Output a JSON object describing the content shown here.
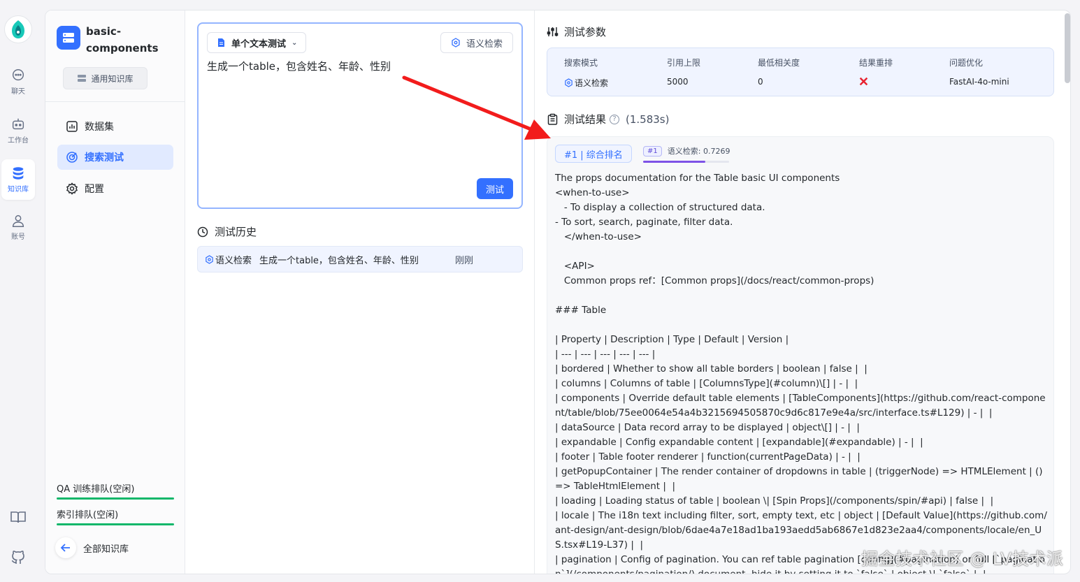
{
  "rail": {
    "items": [
      {
        "label": "聊天",
        "icon": "chat-icon"
      },
      {
        "label": "工作台",
        "icon": "robot-icon"
      },
      {
        "label": "知识库",
        "icon": "database-icon",
        "active": true
      },
      {
        "label": "账号",
        "icon": "user-icon"
      }
    ],
    "bottom_icons": [
      "book-icon",
      "github-icon"
    ]
  },
  "sidebar": {
    "kb_name": "basic-components",
    "kb_type": "通用知识库",
    "nav": [
      {
        "label": "数据集",
        "icon": "dataset-icon"
      },
      {
        "label": "搜索测试",
        "icon": "search-test-icon",
        "active": true
      },
      {
        "label": "配置",
        "icon": "gear-icon"
      }
    ],
    "queues": [
      {
        "label": "QA 训练排队(空闲)"
      },
      {
        "label": "索引排队(空闲)"
      }
    ],
    "back_label": "全部知识库"
  },
  "test_panel": {
    "mode_label": "单个文本测试",
    "search_mode_label": "语义检索",
    "query": "生成一个table，包含姓名、年龄、性别",
    "test_button": "测试",
    "history_title": "测试历史",
    "history": [
      {
        "mode": "语义检索",
        "text": "生成一个table，包含姓名、年龄、性别",
        "time": "刚刚"
      }
    ]
  },
  "params": {
    "title": "测试参数",
    "columns": [
      {
        "label": "搜索模式",
        "value": "语义检索"
      },
      {
        "label": "引用上限",
        "value": "5000"
      },
      {
        "label": "最低相关度",
        "value": "0"
      },
      {
        "label": "结果重排",
        "value": ""
      },
      {
        "label": "问题优化",
        "value": "FastAI-4o-mini"
      }
    ]
  },
  "results": {
    "title": "测试结果",
    "duration": "(1.583s)",
    "items": [
      {
        "rank_tag": "#1 | 综合排名",
        "score_badge": "#1",
        "score_label": "语义检索: 0.7269",
        "score_value": 0.7269,
        "text": "The props documentation for the Table basic UI components\n<when-to-use>\n   - To display a collection of structured data.\n- To sort, search, paginate, filter data.\n   </when-to-use>\n\n   <API>\n   Common props ref：[Common props](/docs/react/common-props)\n\n### Table\n\n| Property | Description | Type | Default | Version |\n| --- | --- | --- | --- | --- |\n| bordered | Whether to show all table borders | boolean | false |  |\n| columns | Columns of table | [ColumnsType](#column)\\[] | - |  |\n| components | Override default table elements | [TableComponents](https://github.com/react-component/table/blob/75ee0064e54a4b3215694505870c9d6c817e9e4a/src/interface.ts#L129) | - |  |\n| dataSource | Data record array to be displayed | object\\[] | - |  |\n| expandable | Config expandable content | [expandable](#expandable) | - |  |\n| footer | Table footer renderer | function(currentPageData) | - |  |\n| getPopupContainer | The render container of dropdowns in table | (triggerNode) => HTMLElement | () => TableHtmlElement |  |\n| loading | Loading status of table | boolean \\| [Spin Props](/components/spin/#api) | false |  |\n| locale | The i18n text including filter, sort, empty text, etc | object | [Default Value](https://github.com/ant-design/ant-design/blob/6dae4a7e18ad1ba193aedd5ab6867e1d823e2aa4/components/locale/en_US.tsx#L19-L37) |  |\n| pagination | Config of pagination. You can ref table pagination [config](#pagination) or full [`pagination`](/components/pagination/) document, hide it by setting it to `false` | object \\| `false` |  |"
      }
    ]
  },
  "watermark": "掘金技术社区 @ LV技术派",
  "colors": {
    "accent": "#3370ff",
    "queue_bar": "#12b76a",
    "arrow": "#f21c1c"
  }
}
